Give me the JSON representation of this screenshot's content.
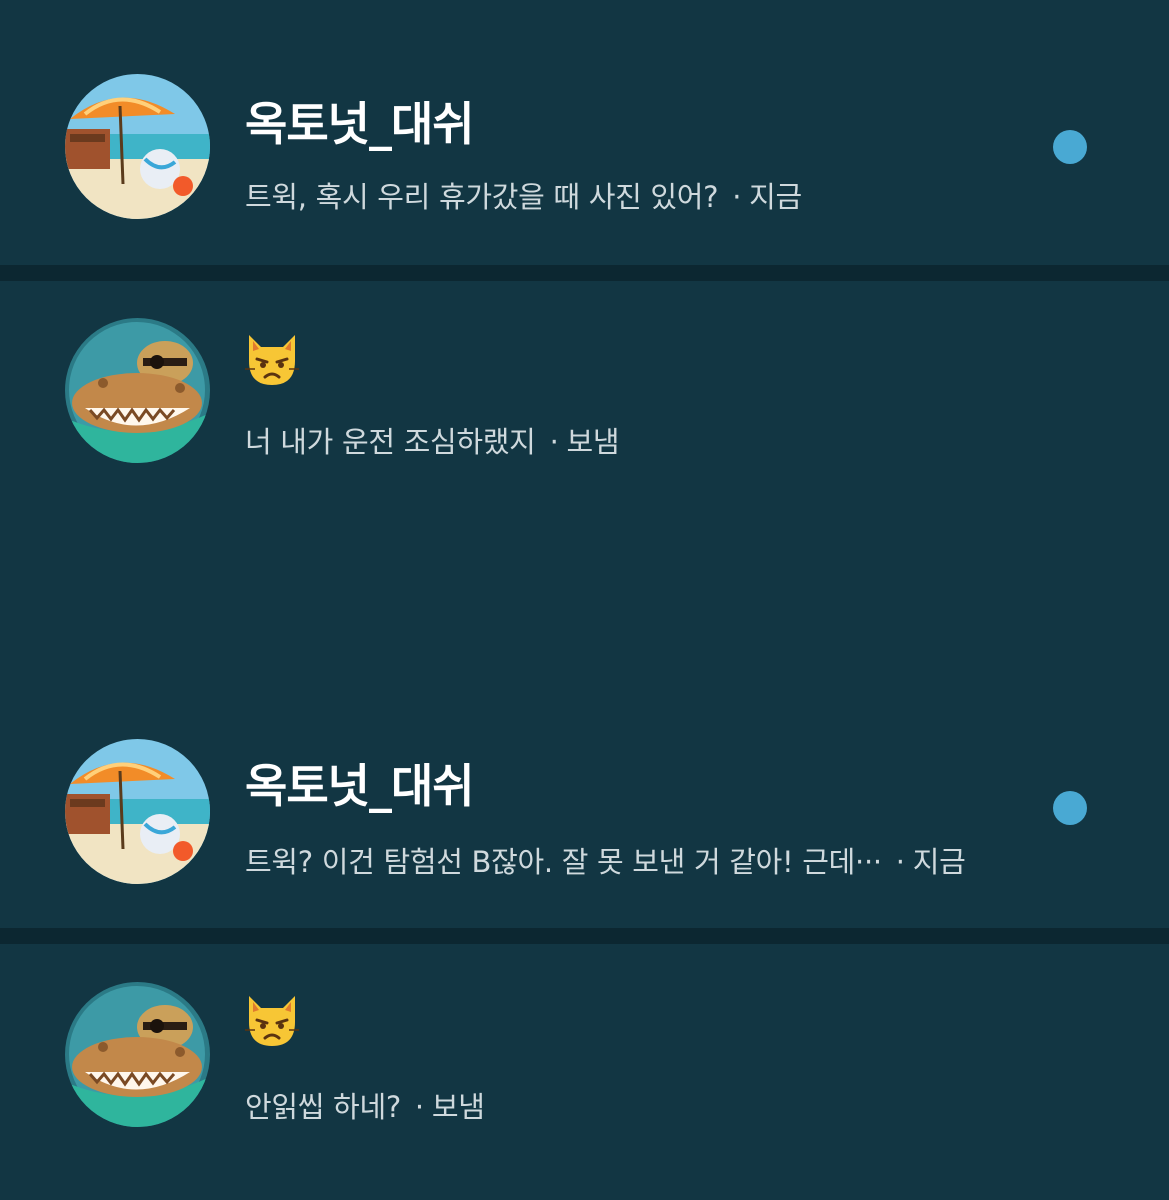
{
  "conversations": [
    {
      "name": "옥토넛_대쉬",
      "name_type": "text",
      "preview": "트윅, 혹시 우리 휴가갔을 때 사진 있어?",
      "status": "지금",
      "unread": true,
      "avatar_icon": "beach-umbrella-avatar-icon"
    },
    {
      "name": "😾",
      "name_type": "emoji",
      "preview": "너 내가 운전 조심하랬지",
      "status": "보냄",
      "unread": false,
      "avatar_icon": "pirate-cat-avatar-icon"
    },
    {
      "name": "옥토넛_대쉬",
      "name_type": "text",
      "preview": "트윅? 이건 탐험선 B잖아. 잘 못 보낸 거 같아! 근데···",
      "status": "지금",
      "unread": true,
      "avatar_icon": "beach-umbrella-avatar-icon"
    },
    {
      "name": "😾",
      "name_type": "emoji",
      "preview": "안읽씹 하네?",
      "status": "보냄",
      "unread": false,
      "avatar_icon": "pirate-cat-avatar-icon"
    }
  ],
  "separator": "·",
  "colors": {
    "background": "#0f303d",
    "row": "#123643",
    "unread_dot": "#49a9d3",
    "name": "#ffffff",
    "preview": "#cfd9dd"
  }
}
